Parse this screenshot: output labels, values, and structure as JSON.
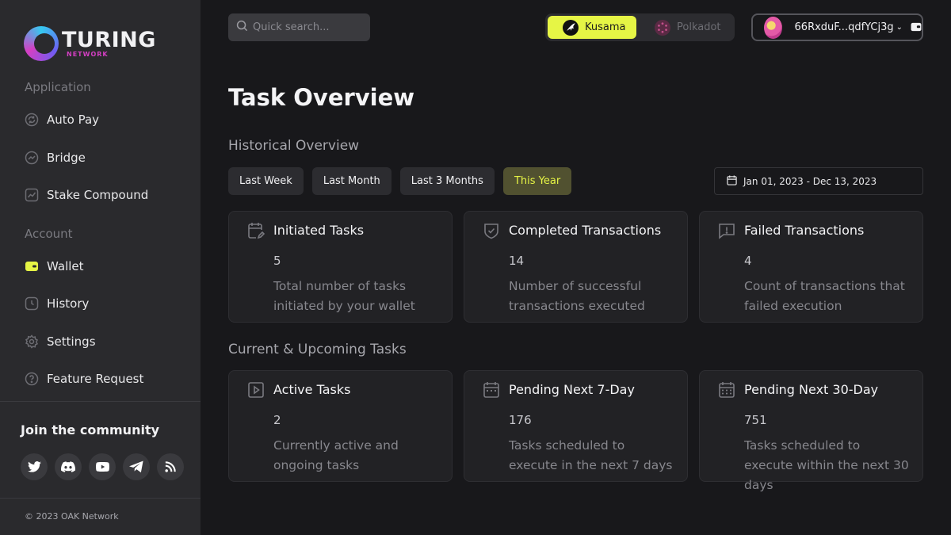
{
  "sidebar": {
    "logo_title": "TURING",
    "logo_subtitle": "NETWORK",
    "section_application": "Application",
    "section_account": "Account",
    "items": [
      {
        "label": "Auto Pay",
        "icon": "auto-pay-icon"
      },
      {
        "label": "Bridge",
        "icon": "bridge-icon"
      },
      {
        "label": "Stake Compound",
        "icon": "chart-icon"
      },
      {
        "label": "Wallet",
        "icon": "wallet-icon"
      },
      {
        "label": "History",
        "icon": "clock-icon"
      },
      {
        "label": "Settings",
        "icon": "gear-icon"
      },
      {
        "label": "Feature Request",
        "icon": "question-icon"
      }
    ],
    "community_title": "Join the community",
    "socials": [
      "twitter-icon",
      "discord-icon",
      "youtube-icon",
      "telegram-icon",
      "rss-icon"
    ],
    "copyright": "© 2023 OAK Network"
  },
  "header": {
    "search_placeholder": "Quick search...",
    "networks": [
      {
        "label": "Kusama",
        "active": true
      },
      {
        "label": "Polkadot",
        "active": false
      }
    ],
    "wallet_address": "66RxduF...qdfYCj3g"
  },
  "main": {
    "title": "Task Overview",
    "historical_title": "Historical Overview",
    "tabs": [
      {
        "label": "Last Week",
        "active": false
      },
      {
        "label": "Last Month",
        "active": false
      },
      {
        "label": "Last 3 Months",
        "active": false
      },
      {
        "label": "This Year",
        "active": true
      }
    ],
    "date_range": "Jan 01, 2023 - Dec 13, 2023",
    "historical_cards": [
      {
        "title": "Initiated Tasks",
        "value": "5",
        "description": "Total number of tasks initiated by your wallet",
        "icon": "calendar-edit-icon"
      },
      {
        "title": "Completed Transactions",
        "value": "14",
        "description": "Number of successful transactions executed",
        "icon": "shield-check-icon"
      },
      {
        "title": "Failed Transactions",
        "value": "4",
        "description": "Count of transactions that failed execution",
        "icon": "message-alert-icon"
      }
    ],
    "upcoming_title": "Current & Upcoming Tasks",
    "upcoming_cards": [
      {
        "title": "Active Tasks",
        "value": "2",
        "description": "Currently active and ongoing tasks",
        "icon": "play-square-icon"
      },
      {
        "title": "Pending Next 7-Day",
        "value": "176",
        "description": "Tasks scheduled to execute in the next 7 days",
        "icon": "calendar-week-icon"
      },
      {
        "title": "Pending Next 30-Day",
        "value": "751",
        "description": "Tasks scheduled to execute within the next 30 days",
        "icon": "calendar-month-icon"
      }
    ]
  },
  "colors": {
    "accent": "#e6f545",
    "sidebar_bg": "#2a2a2d",
    "page_bg": "#18181b",
    "card_bg": "#222225"
  }
}
